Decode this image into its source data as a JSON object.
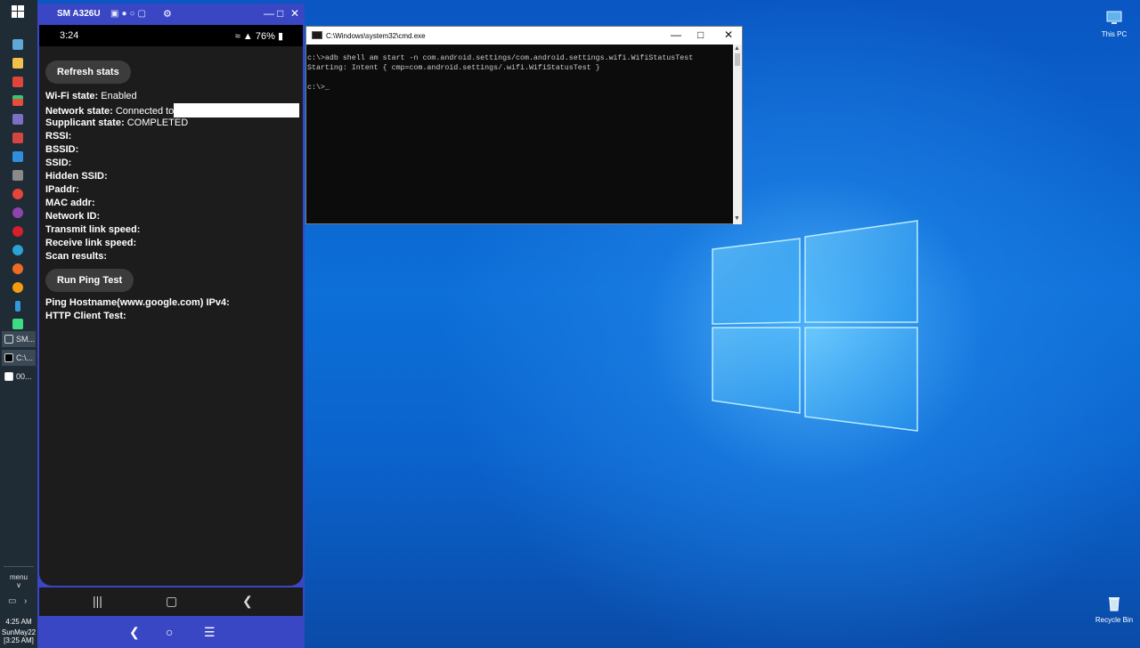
{
  "taskbar": {
    "tasks": [
      {
        "label": "SM..."
      },
      {
        "label": "C:\\..."
      },
      {
        "label": "00..."
      }
    ],
    "menu_label": "menu",
    "time": "4:25 AM",
    "date": "SunMay22",
    "clock_bracket": "[3:25 AM]"
  },
  "phone_window": {
    "title": "SM A326U",
    "status_time": "3:24",
    "status_battery": "76%",
    "refresh_button": "Refresh stats",
    "fields": [
      {
        "label": "Wi-Fi state:",
        "value": "Enabled"
      },
      {
        "label": "Network state:",
        "value": "Connected to"
      },
      {
        "label": "Supplicant state:",
        "value": "COMPLETED"
      },
      {
        "label": "RSSI:",
        "value": ""
      },
      {
        "label": "BSSID:",
        "value": ""
      },
      {
        "label": "SSID:",
        "value": ""
      },
      {
        "label": "Hidden SSID:",
        "value": ""
      },
      {
        "label": "IPaddr:",
        "value": ""
      },
      {
        "label": "MAC addr:",
        "value": ""
      },
      {
        "label": "Network ID:",
        "value": ""
      },
      {
        "label": "Transmit link speed:",
        "value": ""
      },
      {
        "label": "Receive link speed:",
        "value": ""
      },
      {
        "label": "Scan results:",
        "value": ""
      }
    ],
    "ping_button": "Run Ping Test",
    "ping_fields": [
      {
        "label": "Ping Hostname(www.google.com) IPv4:"
      },
      {
        "label": "HTTP Client Test:"
      }
    ]
  },
  "cmd_window": {
    "title": "C:\\Windows\\system32\\cmd.exe",
    "lines": [
      "c:\\>adb shell am start -n com.android.settings/com.android.settings.wifi.WifiStatusTest",
      "Starting: Intent { cmp=com.android.settings/.wifi.WifiStatusTest }",
      "",
      "c:\\>"
    ]
  },
  "desktop_icons": {
    "this_pc": "This PC",
    "recycle_bin": "Recycle Bin"
  },
  "colors": {
    "phone_frame": "#3a47c5",
    "taskbar": "#1f2b35",
    "desktop_blue": "#0b63cc"
  }
}
